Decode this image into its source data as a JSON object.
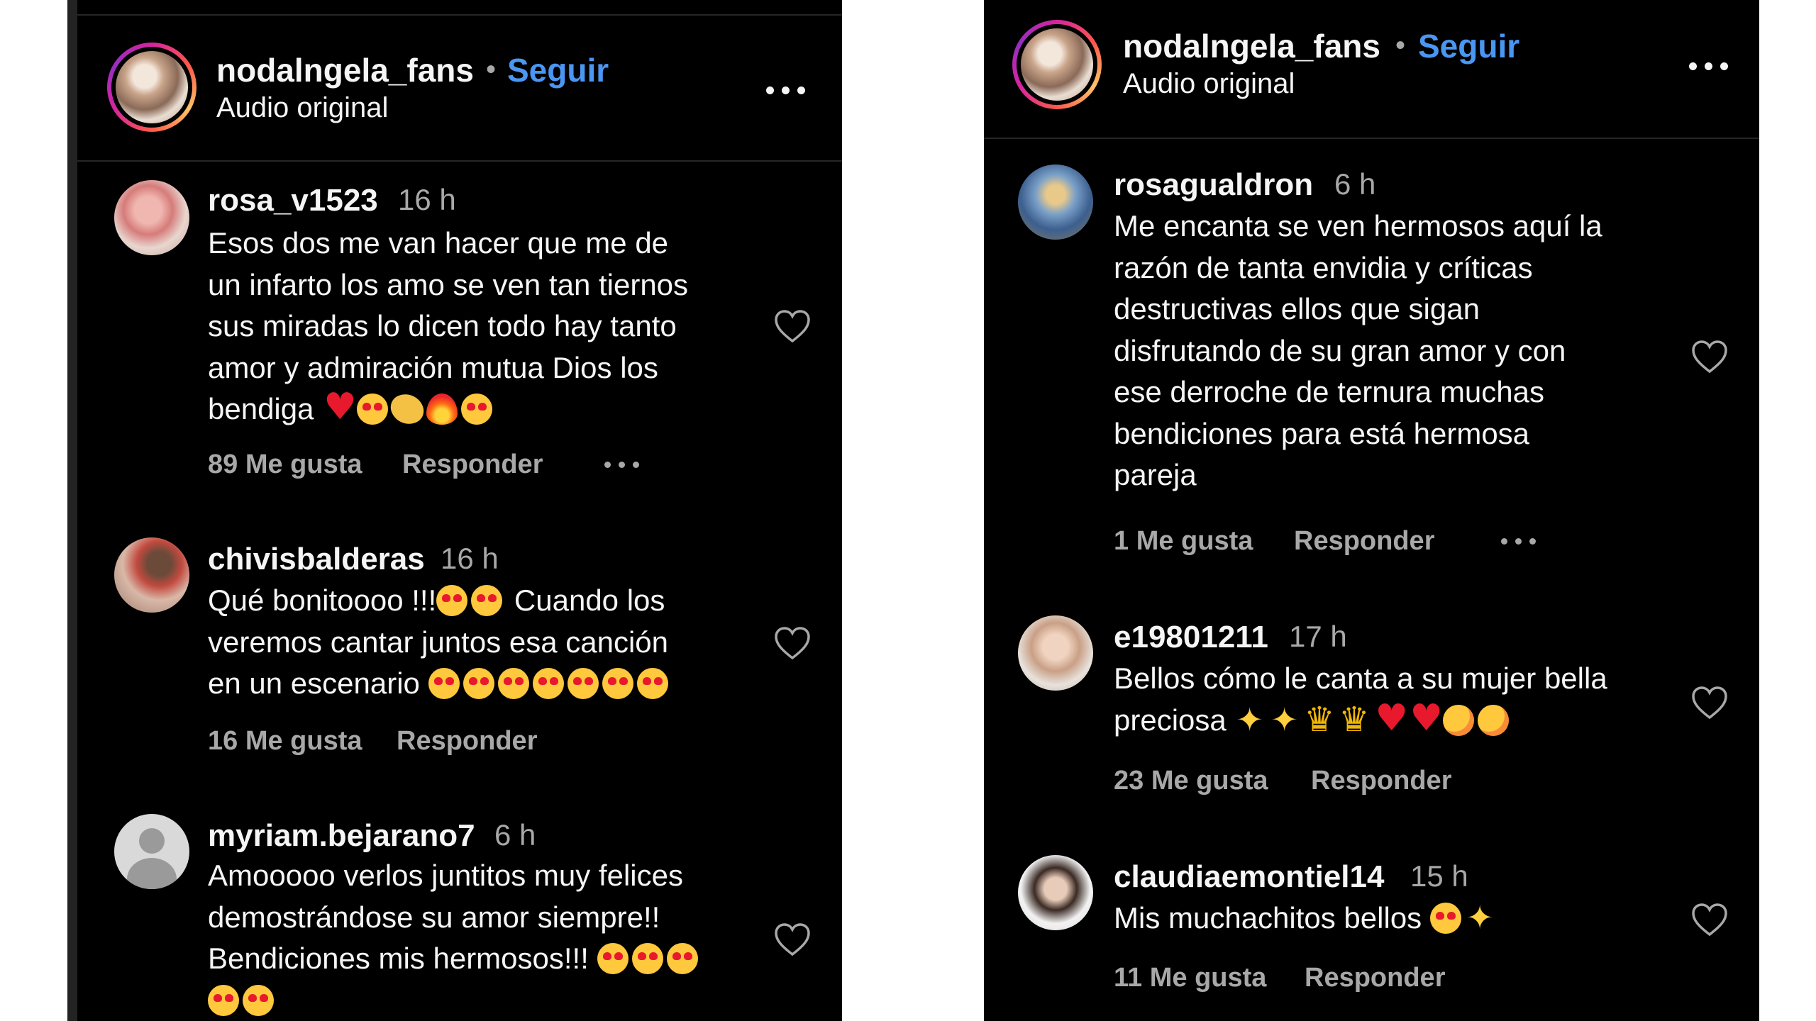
{
  "left": {
    "header": {
      "username": "nodalngela_fans",
      "separator": "•",
      "follow": "Seguir",
      "subtitle": "Audio original"
    },
    "comments": [
      {
        "username": "rosa_v1523",
        "time": "16 h",
        "lines": [
          "Esos dos me van hacer que me de",
          "un infarto los amo se ven tan tiernos",
          "sus miradas lo dicen todo hay tanto",
          "amor y admiración mutua Dios los"
        ],
        "last_line": "bendiga",
        "emojis": [
          "red-heart",
          "heart-eyes",
          "clap",
          "fire",
          "heart-eyes"
        ],
        "likes": "89 Me gusta",
        "reply": "Responder"
      },
      {
        "username": "chivisbalderas",
        "time": "16 h",
        "first_text": "Qué bonitoooo !!!",
        "first_emojis": [
          "heart-eyes",
          "heart-eyes"
        ],
        "first_rest": " Cuando los",
        "line2": "veremos cantar juntos esa canción",
        "line3": "en un escenario",
        "emojis": [
          "heart-eyes",
          "heart-eyes",
          "heart-eyes",
          "heart-eyes",
          "heart-eyes",
          "heart-eyes",
          "heart-eyes"
        ],
        "likes": "16 Me gusta",
        "reply": "Responder"
      },
      {
        "username": "myriam.bejarano7",
        "time": "6 h",
        "lines": [
          "Amooooo verlos juntitos muy felices",
          "demostrándose su amor siempre!!"
        ],
        "line3": "Bendiciones mis hermosos!!! ",
        "line3_emojis": [
          "heart-eyes",
          "heart-eyes",
          "heart-eyes"
        ],
        "line4_emojis": [
          "heart-eyes",
          "heart-eyes"
        ]
      }
    ]
  },
  "right": {
    "header": {
      "username": "nodalngela_fans",
      "separator": "•",
      "follow": "Seguir",
      "subtitle": "Audio original"
    },
    "comments": [
      {
        "username": "rosagualdron",
        "time": "6 h",
        "lines": [
          "Me encanta se ven hermosos aquí la",
          "razón de tanta envidia y críticas",
          "destructivas ellos que sigan",
          "disfrutando de su gran amor y con",
          "ese derroche de ternura muchas",
          "bendiciones para está hermosa",
          "pareja"
        ],
        "likes": "1 Me gusta",
        "reply": "Responder"
      },
      {
        "username": "e19801211",
        "time": "17 h",
        "line1": "Bellos cómo le canta a su mujer bella",
        "line2": "preciosa ",
        "emojis": [
          "sparkles",
          "sparkles",
          "crown",
          "crown",
          "red-heart",
          "red-heart",
          "smiling-hearts",
          "smiling-hearts"
        ],
        "likes": "23 Me gusta",
        "reply": "Responder"
      },
      {
        "username": "claudiaemontiel14",
        "time": "15 h",
        "line1": "Mis muchachitos bellos ",
        "emojis": [
          "heart-eyes",
          "sparkles"
        ],
        "likes": "11 Me gusta",
        "reply": "Responder"
      }
    ]
  }
}
